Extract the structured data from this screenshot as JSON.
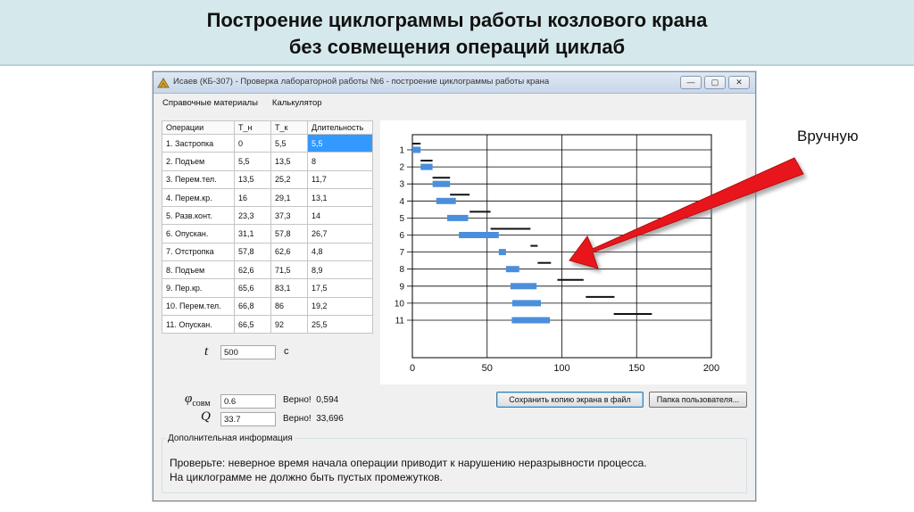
{
  "slide": {
    "title_line1": "Построение циклограммы работы козлового крана",
    "title_line2": "без  совмещения  операций циклаб",
    "side_note": "Вручную",
    "arrow_color": "#e8191b"
  },
  "window": {
    "title": "Исаев (КБ-307) - Проверка лабораторной работы №6 - построение циклограммы работы крана",
    "controls": {
      "minimize": "—",
      "maximize": "▢",
      "close": "✕"
    },
    "menu": [
      "Справочные материалы",
      "Калькулятор"
    ]
  },
  "table": {
    "columns": [
      "Операции",
      "Т_н",
      "Т_к",
      "Длительность"
    ],
    "rows": [
      [
        "1. Застропка",
        "0",
        "5,5",
        "5,5"
      ],
      [
        "2. Подъем",
        "5,5",
        "13,5",
        "8"
      ],
      [
        "3. Перем.тел.",
        "13,5",
        "25,2",
        "11,7"
      ],
      [
        "4. Перем.кр.",
        "16",
        "29,1",
        "13,1"
      ],
      [
        "5. Разв.конт.",
        "23,3",
        "37,3",
        "14"
      ],
      [
        "6. Опускан.",
        "31,1",
        "57,8",
        "26,7"
      ],
      [
        "7. Отстропка",
        "57,8",
        "62,6",
        "4,8"
      ],
      [
        "8. Подъем",
        "62,6",
        "71,5",
        "8,9"
      ],
      [
        "9. Пер.кр.",
        "65,6",
        "83,1",
        "17,5"
      ],
      [
        "10. Перем.тел.",
        "66,8",
        "86",
        "19,2"
      ],
      [
        "11. Опускан.",
        "66,5",
        "92",
        "25,5"
      ]
    ]
  },
  "inputs": {
    "t_label": "t",
    "t_value": "500",
    "t_unit": "с",
    "phi_label": "φ",
    "phi_sub": "совм",
    "phi_value": "0.6",
    "phi_result_label": "Верно!",
    "phi_result_value": "0,594",
    "q_label": "Q",
    "q_value": "33.7",
    "q_result_label": "Верно!",
    "q_result_value": "33,696"
  },
  "buttons": {
    "save": "Сохранить копию экрана в файл",
    "folder": "Папка пользователя..."
  },
  "info": {
    "legend": "Дополнительная информация",
    "line1": "Проверьте: неверное время начала операции приводит к нарушению неразрывности процесса.",
    "line2": "На циклограмме не должно быть пустых промежутков."
  },
  "chart_data": {
    "type": "gantt",
    "xlim": [
      0,
      200
    ],
    "x_ticks": [
      "0",
      "50",
      "100",
      "150",
      "200"
    ],
    "y_ticks": [
      "1",
      "2",
      "3",
      "4",
      "5",
      "6",
      "7",
      "8",
      "9",
      "10",
      "11"
    ],
    "grid": true,
    "bar_color": "#4a8fdc",
    "reference_color": "#111111",
    "bars": [
      {
        "start": 0,
        "end": 5.5
      },
      {
        "start": 5.5,
        "end": 13.5
      },
      {
        "start": 13.5,
        "end": 25.2
      },
      {
        "start": 16,
        "end": 29.1
      },
      {
        "start": 23.3,
        "end": 37.3
      },
      {
        "start": 31.1,
        "end": 57.8
      },
      {
        "start": 57.8,
        "end": 62.6
      },
      {
        "start": 62.6,
        "end": 71.5
      },
      {
        "start": 65.6,
        "end": 83.1
      },
      {
        "start": 66.8,
        "end": 86
      },
      {
        "start": 66.5,
        "end": 92
      }
    ],
    "reference": [
      {
        "start": 0,
        "end": 5.5
      },
      {
        "start": 5.5,
        "end": 13.5
      },
      {
        "start": 13.5,
        "end": 25.2
      },
      {
        "start": 25.2,
        "end": 38.3
      },
      {
        "start": 38.3,
        "end": 52.3
      },
      {
        "start": 52.3,
        "end": 79
      },
      {
        "start": 79,
        "end": 83.8
      },
      {
        "start": 83.8,
        "end": 92.7
      },
      {
        "start": 97,
        "end": 114.5
      },
      {
        "start": 116,
        "end": 135.2
      },
      {
        "start": 134.7,
        "end": 160.2
      }
    ]
  }
}
